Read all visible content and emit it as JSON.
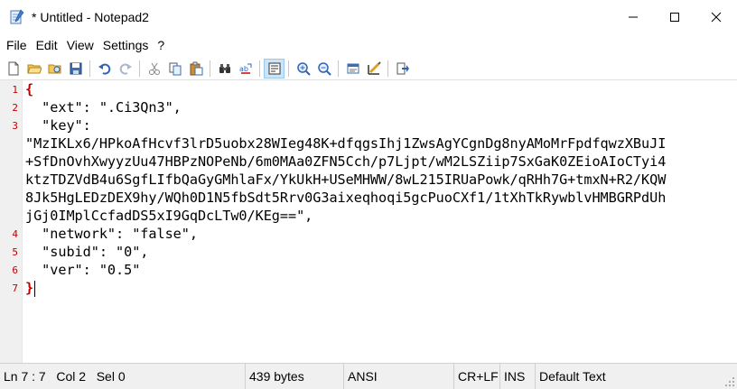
{
  "window": {
    "title": "* Untitled - Notepad2"
  },
  "menu": [
    "File",
    "Edit",
    "View",
    "Settings",
    "?"
  ],
  "toolbar": {
    "icons": [
      "new-file-icon",
      "open-folder-icon",
      "browse-icon",
      "save-icon",
      "undo-icon",
      "redo-icon",
      "cut-icon",
      "copy-icon",
      "paste-icon",
      "find-icon",
      "replace-icon",
      "word-wrap-icon",
      "zoom-in-icon",
      "zoom-out-icon",
      "scheme-icon",
      "customize-scheme-icon",
      "always-on-top-icon"
    ]
  },
  "editor": {
    "line_numbers": [
      "1",
      "2",
      "3",
      "4",
      "5",
      "6",
      "7"
    ],
    "lines": [
      "{",
      "  \"ext\": \".Ci3Qn3\",",
      "  \"key\":",
      "\"MzIKLx6/HPkoAfHcvf3lrD5uobx28WIeg48K+dfqgsIhj1ZwsAgYCgnDg8nyAMoMrFpdfqwzXBuJI",
      "+SfDnOvhXwyyzUu47HBPzNOPeNb/6m0MAa0ZFN5Cch/p7Ljpt/wM2LSZiip7SxGaK0ZEioAIoCTyi4",
      "ktzTDZVdB4u6SgfLIfbQaGyGMhlaFx/YkUkH+USeMHWW/8wL215IRUaPowk/qRHh7G+tmxN+R2/KQW",
      "8Jk5HgLEDzDEX9hy/WQh0D1N5fbSdt5Rrv0G3aixeqhoqi5gcPuoCXf1/1tXhTkRywblvHMBGRPdUh",
      "jGj0IMplCcfadDS5xI9GqDcLTw0/KEg==\",",
      "  \"network\": \"false\",",
      "  \"subid\": \"0\",",
      "  \"ver\": \"0.5\"",
      "}"
    ]
  },
  "status": {
    "position": "Ln 7 : 7   Col 2   Sel 0",
    "size": "439 bytes",
    "encoding": "ANSI",
    "line_endings": "CR+LF",
    "insert_mode": "INS",
    "scheme": "Default Text"
  }
}
